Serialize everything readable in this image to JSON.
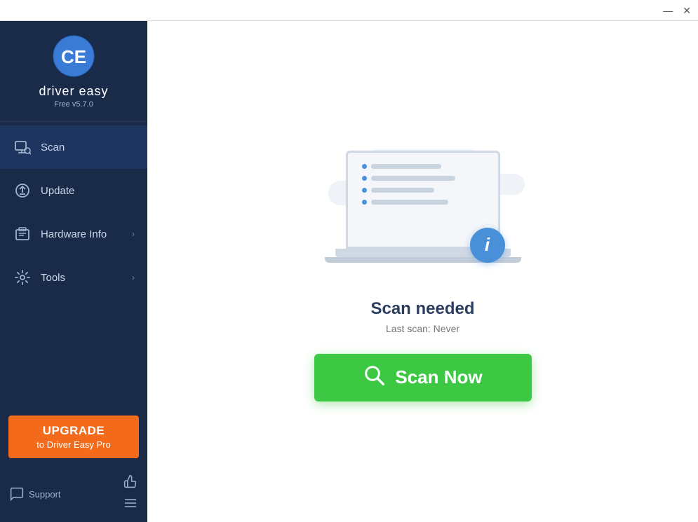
{
  "titlebar": {
    "minimize_label": "—",
    "close_label": "✕"
  },
  "sidebar": {
    "logo": {
      "text": "driver easy",
      "version": "Free v5.7.0"
    },
    "nav_items": [
      {
        "id": "scan",
        "label": "Scan",
        "active": true,
        "has_arrow": false
      },
      {
        "id": "update",
        "label": "Update",
        "active": false,
        "has_arrow": false
      },
      {
        "id": "hardware-info",
        "label": "Hardware Info",
        "active": false,
        "has_arrow": true
      },
      {
        "id": "tools",
        "label": "Tools",
        "active": false,
        "has_arrow": true
      }
    ],
    "upgrade": {
      "line1": "UPGRADE",
      "line2": "to Driver Easy Pro"
    },
    "support": {
      "label": "Support"
    }
  },
  "main": {
    "scan_title": "Scan needed",
    "scan_subtitle": "Last scan: Never",
    "scan_button": "Scan Now"
  }
}
